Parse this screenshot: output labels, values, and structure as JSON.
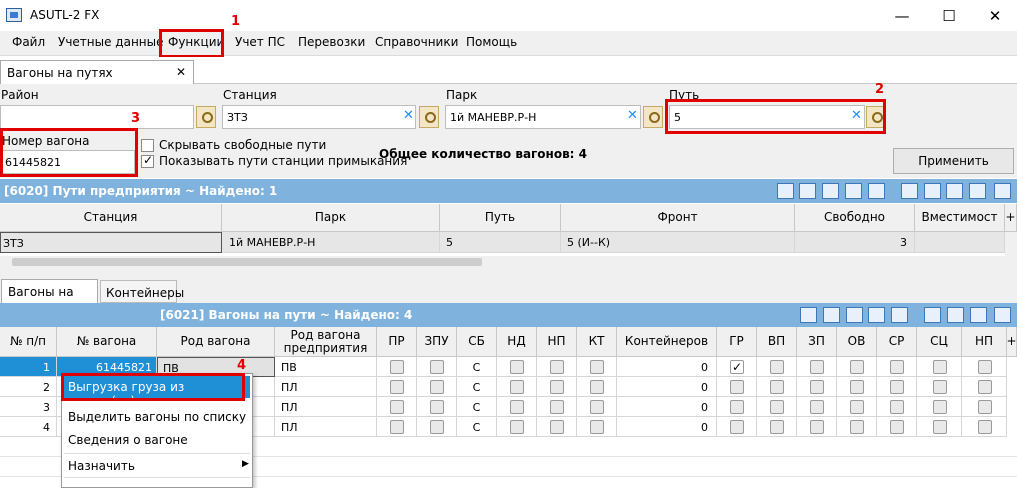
{
  "window": {
    "title": "ASUTL-2 FX",
    "minimize": "—",
    "maximize": "☐",
    "close": "✕"
  },
  "menu": [
    "Файл",
    "Учетные данные",
    "Функции",
    "Учет ПС",
    "Перевозки",
    "Справочники",
    "Помощь"
  ],
  "doc_tab": {
    "label": "Вагоны на путях предприятия",
    "close": "✕"
  },
  "filters": {
    "rayon_label": "Район",
    "rayon_value": "",
    "station_label": "Станция",
    "station_value": "ЗТЗ",
    "park_label": "Парк",
    "park_value": "1й МАНЕВР.Р-Н",
    "put_label": "Путь",
    "put_value": "5",
    "wagon_label": "Номер вагона",
    "wagon_value": "61445821",
    "hide_free": "Скрывать свободные пути",
    "show_adjacent": "Показывать пути станции примыкания",
    "total": "Общее количество вагонов: 4",
    "apply": "Применить"
  },
  "annotations": [
    "1",
    "2",
    "3",
    "4"
  ],
  "grid1": {
    "header": "[6020]  Пути предприятия ~ Найдено: 1",
    "columns": [
      "Станция",
      "Парк",
      "Путь",
      "Фронт",
      "Свободно",
      "Вместимост"
    ],
    "row": [
      "ЗТЗ",
      "1й МАНЕВР.Р-Н",
      "5",
      "5 (И--К)",
      "3",
      ""
    ]
  },
  "lower_tabs": [
    "Вагоны на пути",
    "Контейнеры"
  ],
  "grid2": {
    "header": "[6021]  Вагоны на пути ~ Найдено: 4",
    "columns": [
      "№ п/п",
      "№ вагона",
      "Род вагона",
      "Род вагона предприятия",
      "ПР",
      "ЗПУ",
      "СБ",
      "НД",
      "НП",
      "КТ",
      "Контейнеров",
      "ГР",
      "ВП",
      "ЗП",
      "ОВ",
      "СР",
      "СЦ",
      "НП"
    ],
    "rows": [
      {
        "n": "1",
        "wagon": "61445821",
        "rod": "ПВ",
        "rodp": "ПВ",
        "sb": "С",
        "cont": "0",
        "gr": true
      },
      {
        "n": "2",
        "wagon": "",
        "rod": "",
        "rodp": "ПЛ",
        "sb": "С",
        "cont": "0",
        "gr": false
      },
      {
        "n": "3",
        "wagon": "",
        "rod": "",
        "rodp": "ПЛ",
        "sb": "С",
        "cont": "0",
        "gr": false
      },
      {
        "n": "4",
        "wagon": "",
        "rod": "",
        "rodp": "ПЛ",
        "sb": "С",
        "cont": "0",
        "gr": false
      }
    ]
  },
  "context_menu": [
    "Выгрузка груза из вагона(ов)",
    "Выделить вагоны по списку",
    "Сведения о вагоне",
    "Назначить"
  ],
  "colors": {
    "grid_header": "#7fb3dd",
    "highlight": "#1f8fd6",
    "annotation": "#e00000"
  }
}
